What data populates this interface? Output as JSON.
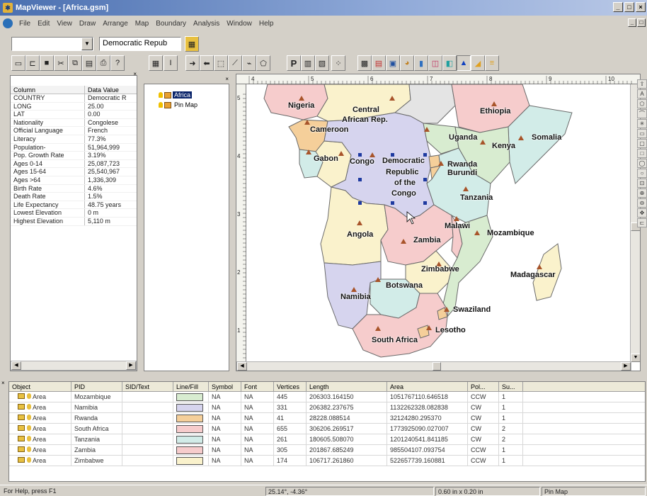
{
  "window": {
    "title": "MapViewer - [Africa.gsm]",
    "controls": [
      "_",
      "□",
      "×"
    ]
  },
  "menu": [
    "File",
    "Edit",
    "View",
    "Draw",
    "Arrange",
    "Map",
    "Boundary",
    "Analysis",
    "Window",
    "Help"
  ],
  "selector": {
    "left_value": "",
    "object_value": "Democratic Repub"
  },
  "properties": {
    "header": {
      "col1": "Column",
      "col2": "Data Value"
    },
    "rows": [
      {
        "k": "COUNTRY",
        "v": "Democratic R"
      },
      {
        "k": "LONG",
        "v": "25.00"
      },
      {
        "k": "LAT",
        "v": "0.00"
      },
      {
        "k": "Nationality",
        "v": "Congolese"
      },
      {
        "k": "Official Language",
        "v": "French"
      },
      {
        "k": "Literacy",
        "v": "77.3%"
      },
      {
        "k": "Population-",
        "v": "51,964,999"
      },
      {
        "k": "Pop. Growth Rate",
        "v": "3.19%"
      },
      {
        "k": "Ages 0-14",
        "v": "25,087,723"
      },
      {
        "k": "Ages 15-64",
        "v": "25,540,967"
      },
      {
        "k": "Ages >64",
        "v": "1,336,309"
      },
      {
        "k": "Birth Rate",
        "v": "4.6%"
      },
      {
        "k": "Death Rate",
        "v": "1.5%"
      },
      {
        "k": "Life Expectancy",
        "v": "48.75 years"
      },
      {
        "k": "Lowest Elevation",
        "v": "0 m"
      },
      {
        "k": "Highest Elevation",
        "v": "5,110 m"
      }
    ]
  },
  "tree": {
    "items": [
      {
        "label": "Africa",
        "selected": true
      },
      {
        "label": "Pin Map",
        "selected": false
      }
    ]
  },
  "rulers": {
    "top_ticks": [
      "4",
      "5",
      "6",
      "7",
      "8",
      "9",
      "10"
    ],
    "left_ticks": [
      "5",
      "4",
      "3",
      "2",
      "1"
    ]
  },
  "map_labels": [
    {
      "id": "nigeria",
      "text": "Nigeria"
    },
    {
      "id": "car1",
      "text": "Central"
    },
    {
      "id": "car2",
      "text": "African Rep."
    },
    {
      "id": "ethiopia",
      "text": "Ethiopia"
    },
    {
      "id": "cameroon",
      "text": "Cameroon"
    },
    {
      "id": "uganda",
      "text": "Uganda"
    },
    {
      "id": "somalia",
      "text": "Somalia"
    },
    {
      "id": "kenya",
      "text": "Kenya"
    },
    {
      "id": "gabon",
      "text": "Gabon"
    },
    {
      "id": "congo",
      "text": "Congo"
    },
    {
      "id": "drc1",
      "text": "Democratic"
    },
    {
      "id": "drc2",
      "text": "Republic"
    },
    {
      "id": "drc3",
      "text": "of the"
    },
    {
      "id": "drc4",
      "text": "Congo"
    },
    {
      "id": "rwanda",
      "text": "Rwanda"
    },
    {
      "id": "burundi",
      "text": "Burundi"
    },
    {
      "id": "tanzania",
      "text": "Tanzania"
    },
    {
      "id": "angola",
      "text": "Angola"
    },
    {
      "id": "malawi",
      "text": "Malawi"
    },
    {
      "id": "zambia",
      "text": "Zambia"
    },
    {
      "id": "mozambique",
      "text": "Mozambique"
    },
    {
      "id": "zimbabwe",
      "text": "Zimbabwe"
    },
    {
      "id": "madagascar",
      "text": "Madagascar"
    },
    {
      "id": "namibia",
      "text": "Namibia"
    },
    {
      "id": "botswana",
      "text": "Botswana"
    },
    {
      "id": "swaziland",
      "text": "Swaziland"
    },
    {
      "id": "lesotho",
      "text": "Lesotho"
    },
    {
      "id": "southafrica",
      "text": "South Africa"
    }
  ],
  "grid": {
    "columns": [
      "Object",
      "PID",
      "SID/Text",
      "Line/Fill",
      "Symbol",
      "Font",
      "Vertices",
      "Length",
      "Area",
      "Pol...",
      "Su..."
    ],
    "rows": [
      {
        "object": "Area",
        "pid": "Mozambique",
        "sid": "",
        "fill": "#d8ecd0",
        "symbol": "NA",
        "font": "NA",
        "vertices": "445",
        "length": "206303.164150",
        "area": "1051767110.646518",
        "pol": "CCW",
        "su": "1"
      },
      {
        "object": "Area",
        "pid": "Namibia",
        "sid": "",
        "fill": "#d6d4ee",
        "symbol": "NA",
        "font": "NA",
        "vertices": "331",
        "length": "206382.237675",
        "area": "1132262328.082838",
        "pol": "CW",
        "su": "1"
      },
      {
        "object": "Area",
        "pid": "Rwanda",
        "sid": "",
        "fill": "#f5cf9a",
        "symbol": "NA",
        "font": "NA",
        "vertices": "41",
        "length": "28228.088514",
        "area": "32124280.295370",
        "pol": "CW",
        "su": "1"
      },
      {
        "object": "Area",
        "pid": "South Africa",
        "sid": "",
        "fill": "#f6cccc",
        "symbol": "NA",
        "font": "NA",
        "vertices": "655",
        "length": "306206.269517",
        "area": "1773925090.027007",
        "pol": "CW",
        "su": "2"
      },
      {
        "object": "Area",
        "pid": "Tanzania",
        "sid": "",
        "fill": "#d2ece8",
        "symbol": "NA",
        "font": "NA",
        "vertices": "261",
        "length": "180605.508070",
        "area": "1201240541.841185",
        "pol": "CW",
        "su": "2"
      },
      {
        "object": "Area",
        "pid": "Zambia",
        "sid": "",
        "fill": "#f6cccc",
        "symbol": "NA",
        "font": "NA",
        "vertices": "305",
        "length": "201867.685249",
        "area": "985504107.093754",
        "pol": "CCW",
        "su": "1"
      },
      {
        "object": "Area",
        "pid": "Zimbabwe",
        "sid": "",
        "fill": "#faf2cc",
        "symbol": "NA",
        "font": "NA",
        "vertices": "174",
        "length": "106717.261860",
        "area": "522657739.160881",
        "pol": "CCW",
        "su": "1"
      }
    ]
  },
  "status": {
    "help": "For Help, press F1",
    "coords": "25.14°, -4.36°",
    "size": "0.60 in x 0.20 in",
    "layer": "Pin Map"
  },
  "colors": {
    "title_start": "#4a6fb0",
    "selection": "#0a246a",
    "marker": "#a8542a",
    "handle": "#1e3aa0"
  }
}
